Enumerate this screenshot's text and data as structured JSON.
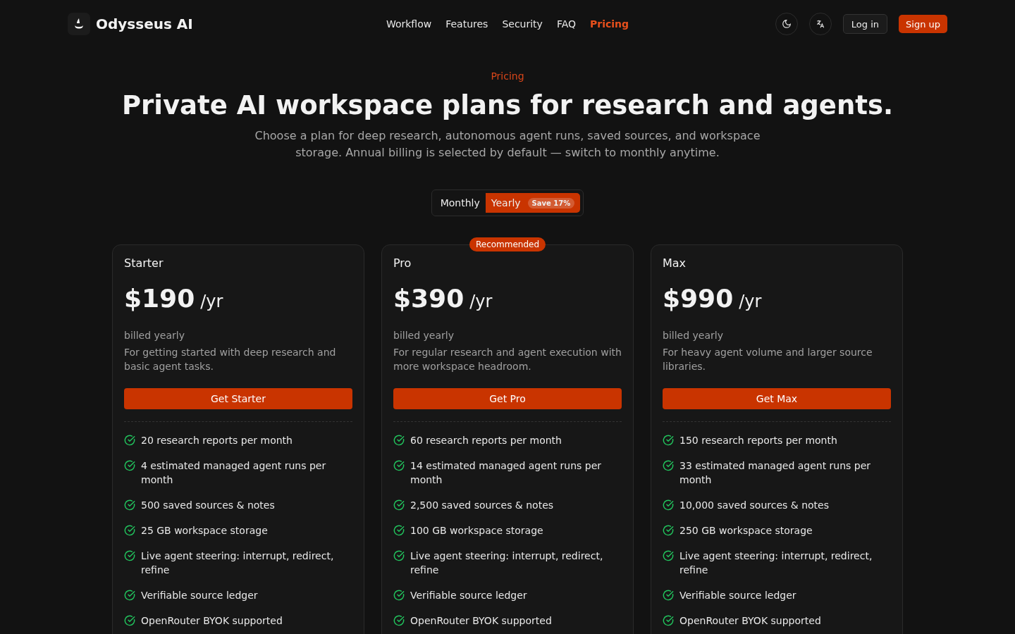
{
  "header": {
    "brand": "Odysseus AI",
    "nav": [
      {
        "label": "Workflow",
        "selected": false
      },
      {
        "label": "Features",
        "selected": false
      },
      {
        "label": "Security",
        "selected": false
      },
      {
        "label": "FAQ",
        "selected": false
      },
      {
        "label": "Pricing",
        "selected": true
      }
    ],
    "login": "Log in",
    "signup": "Sign up"
  },
  "hero": {
    "eyebrow": "Pricing",
    "title": "Private AI workspace plans for research and agents.",
    "subtitle": "Choose a plan for deep research, autonomous agent runs, saved sources, and workspace storage. Annual billing is selected by default — switch to monthly anytime."
  },
  "billing": [
    {
      "label": "Monthly",
      "selected": false
    },
    {
      "label": "Yearly",
      "selected": true,
      "badge": "Save 17%"
    }
  ],
  "plans": [
    {
      "name": "Starter",
      "price": "$190",
      "period": "/yr",
      "billing": "billed yearly",
      "description": "For getting started with deep research and basic agent tasks.",
      "cta": "Get Starter",
      "features": [
        "20 research reports per month",
        "4 estimated managed agent runs per month",
        "500 saved sources & notes",
        "25 GB workspace storage",
        "Live agent steering: interrupt, redirect, refine",
        "Verifiable source ledger",
        "OpenRouter BYOK supported"
      ]
    },
    {
      "name": "Pro",
      "badge": "Recommended",
      "price": "$390",
      "period": "/yr",
      "billing": "billed yearly",
      "description": "For regular research and agent execution with more workspace headroom.",
      "cta": "Get Pro",
      "features": [
        "60 research reports per month",
        "14 estimated managed agent runs per month",
        "2,500 saved sources & notes",
        "100 GB workspace storage",
        "Live agent steering: interrupt, redirect, refine",
        "Verifiable source ledger",
        "OpenRouter BYOK supported"
      ]
    },
    {
      "name": "Max",
      "price": "$990",
      "period": "/yr",
      "billing": "billed yearly",
      "description": "For heavy agent volume and larger source libraries.",
      "cta": "Get Max",
      "features": [
        "150 research reports per month",
        "33 estimated managed agent runs per month",
        "10,000 saved sources & notes",
        "250 GB workspace storage",
        "Live agent steering: interrupt, redirect, refine",
        "Verifiable source ledger",
        "OpenRouter BYOK supported"
      ]
    }
  ]
}
